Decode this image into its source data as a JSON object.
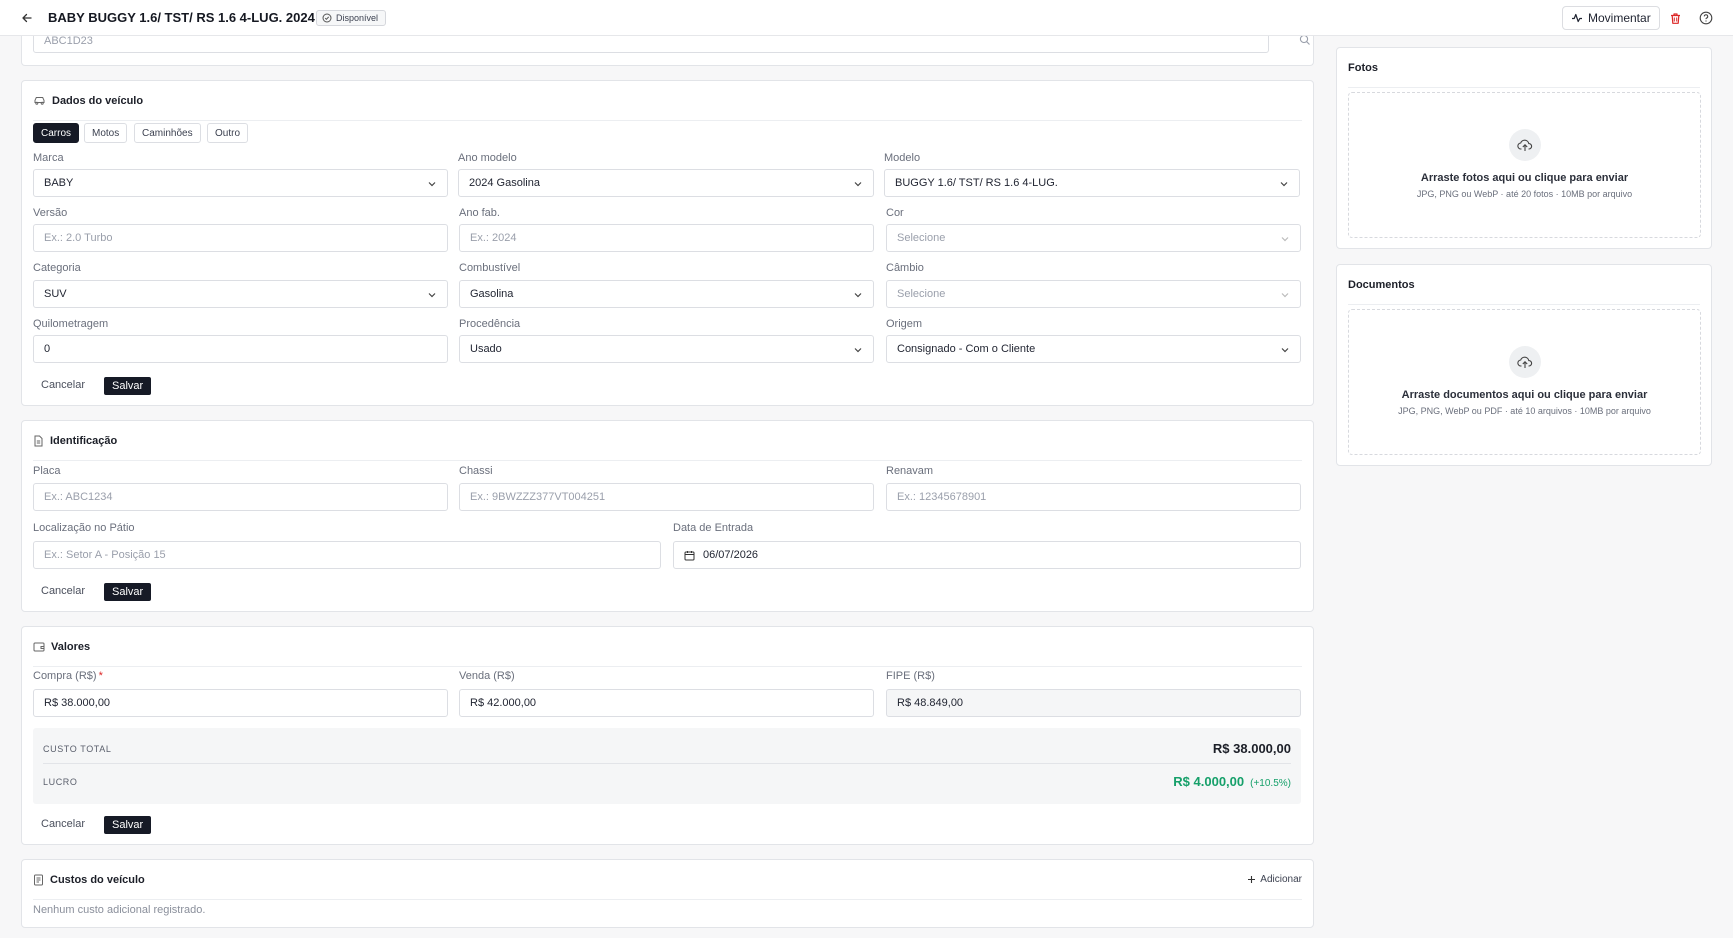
{
  "header": {
    "title": "BABY BUGGY 1.6/ TST/ RS 1.6 4-LUG. 2024",
    "status": "Disponível",
    "move_label": "Movimentar"
  },
  "search": {
    "value": "ABC1D23"
  },
  "vehicle": {
    "title": "Dados do veículo",
    "tabs": [
      "Carros",
      "Motos",
      "Caminhões",
      "Outro"
    ],
    "active_tab": "Carros",
    "fields": {
      "marca": {
        "label": "Marca",
        "value": "BABY"
      },
      "ano_modelo": {
        "label": "Ano modelo",
        "value": "2024 Gasolina"
      },
      "modelo": {
        "label": "Modelo",
        "value": "BUGGY 1.6/ TST/ RS 1.6 4-LUG."
      },
      "versao": {
        "label": "Versão",
        "placeholder": "Ex.: 2.0 Turbo"
      },
      "ano_fab": {
        "label": "Ano fab.",
        "placeholder": "Ex.: 2024"
      },
      "cor": {
        "label": "Cor",
        "placeholder": "Selecione"
      },
      "categoria": {
        "label": "Categoria",
        "value": "SUV"
      },
      "combustivel": {
        "label": "Combustível",
        "value": "Gasolina"
      },
      "cambio": {
        "label": "Câmbio",
        "placeholder": "Selecione"
      },
      "quilometragem": {
        "label": "Quilometragem",
        "value": "0"
      },
      "procedencia": {
        "label": "Procedência",
        "value": "Usado"
      },
      "origem": {
        "label": "Origem",
        "value": "Consignado - Com o Cliente"
      }
    },
    "cancel_label": "Cancelar",
    "save_label": "Salvar"
  },
  "identification": {
    "title": "Identificação",
    "fields": {
      "placa": {
        "label": "Placa",
        "placeholder": "Ex.: ABC1234"
      },
      "chassi": {
        "label": "Chassi",
        "placeholder": "Ex.: 9BWZZZ377VT004251"
      },
      "renavam": {
        "label": "Renavam",
        "placeholder": "Ex.: 12345678901"
      },
      "localizacao": {
        "label": "Localização no Pátio",
        "placeholder": "Ex.: Setor A - Posição 15"
      },
      "data_entrada": {
        "label": "Data de Entrada",
        "value": "06/07/2026"
      }
    },
    "cancel_label": "Cancelar",
    "save_label": "Salvar"
  },
  "values": {
    "title": "Valores",
    "compra": {
      "label": "Compra (R$)",
      "required_mark": "*",
      "value": "R$ 38.000,00"
    },
    "venda": {
      "label": "Venda (R$)",
      "value": "R$ 42.000,00"
    },
    "fipe": {
      "label": "FIPE (R$)",
      "value": "R$ 48.849,00"
    },
    "custo_total": {
      "label": "CUSTO TOTAL",
      "value": "R$ 38.000,00"
    },
    "lucro": {
      "label": "LUCRO",
      "value": "R$ 4.000,00",
      "pct": "(+10.5%)"
    },
    "profit_color": "#16a06a",
    "cancel_label": "Cancelar",
    "save_label": "Salvar"
  },
  "costs": {
    "title": "Custos do veículo",
    "add_label": "Adicionar",
    "empty": "Nenhum custo adicional registrado."
  },
  "photos": {
    "title": "Fotos",
    "drop_title": "Arraste fotos aqui ou clique para enviar",
    "drop_sub": "JPG, PNG ou WebP · até 20 fotos · 10MB por arquivo"
  },
  "documents": {
    "title": "Documentos",
    "drop_title": "Arraste documentos aqui ou clique para enviar",
    "drop_sub": "JPG, PNG, WebP ou PDF · até 10 arquivos · 10MB por arquivo"
  },
  "icons": [
    "arrow-left-icon",
    "check-circle-icon",
    "activity-icon",
    "trash-icon",
    "help-circle-icon",
    "search-icon",
    "car-icon",
    "file-icon",
    "wallet-icon",
    "receipt-icon",
    "plus-icon",
    "chevron-down-icon",
    "calendar-icon",
    "upload-cloud-icon"
  ],
  "colors": {
    "primary": "#161a26",
    "danger": "#dc2626",
    "profit": "#16a06a"
  }
}
